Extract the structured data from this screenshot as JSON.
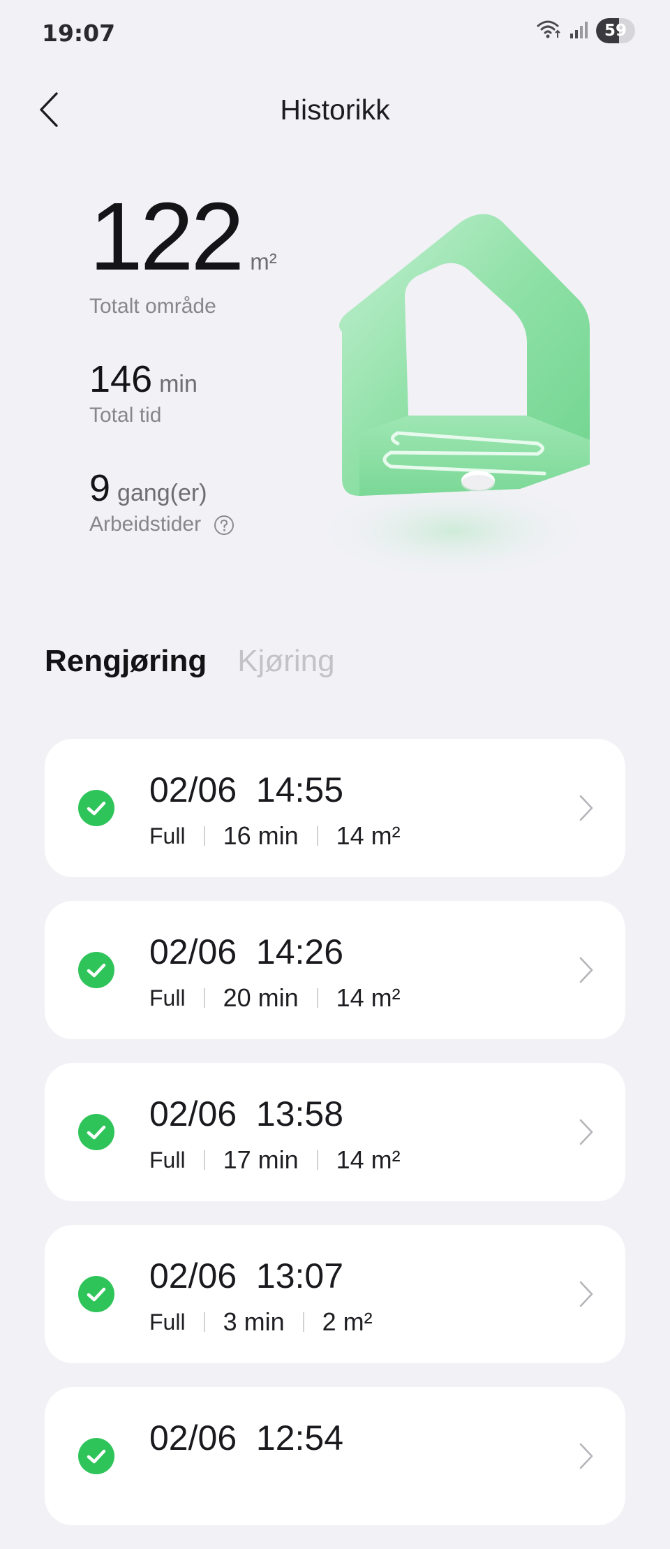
{
  "status_bar": {
    "time": "19:07",
    "battery_percent": "59",
    "battery_level": 0.59,
    "wifi_label": "5",
    "icons": [
      "wifi-icon",
      "signal-icon",
      "battery-icon"
    ]
  },
  "header": {
    "title": "Historikk",
    "back_icon": "chevron-left-icon"
  },
  "stats": {
    "area_value": "122",
    "area_unit": "m²",
    "area_label": "Totalt område",
    "time_value": "146",
    "time_unit": "min",
    "time_label": "Total tid",
    "count_value": "9",
    "count_unit": "gang(er)",
    "count_label": "Arbeidstider",
    "help_icon": "help-circle-icon"
  },
  "illustration": {
    "name": "house-illustration",
    "color": "#8fe0a6"
  },
  "tabs": [
    {
      "label": "Rengjøring",
      "active": true
    },
    {
      "label": "Kjøring",
      "active": false
    }
  ],
  "colors": {
    "accent_green": "#2fc45a",
    "background": "#f1f1f6",
    "card": "#ffffff"
  },
  "history": [
    {
      "date": "02/06",
      "time": "14:55",
      "mode": "Full",
      "duration": "16 min",
      "area": "14 m²",
      "status_icon": "check-circle-icon"
    },
    {
      "date": "02/06",
      "time": "14:26",
      "mode": "Full",
      "duration": "20 min",
      "area": "14 m²",
      "status_icon": "check-circle-icon"
    },
    {
      "date": "02/06",
      "time": "13:58",
      "mode": "Full",
      "duration": "17 min",
      "area": "14 m²",
      "status_icon": "check-circle-icon"
    },
    {
      "date": "02/06",
      "time": "13:07",
      "mode": "Full",
      "duration": "3 min",
      "area": "2 m²",
      "status_icon": "check-circle-icon"
    },
    {
      "date": "02/06",
      "time": "12:54",
      "mode": "",
      "duration": "",
      "area": "",
      "status_icon": "check-circle-icon"
    }
  ]
}
